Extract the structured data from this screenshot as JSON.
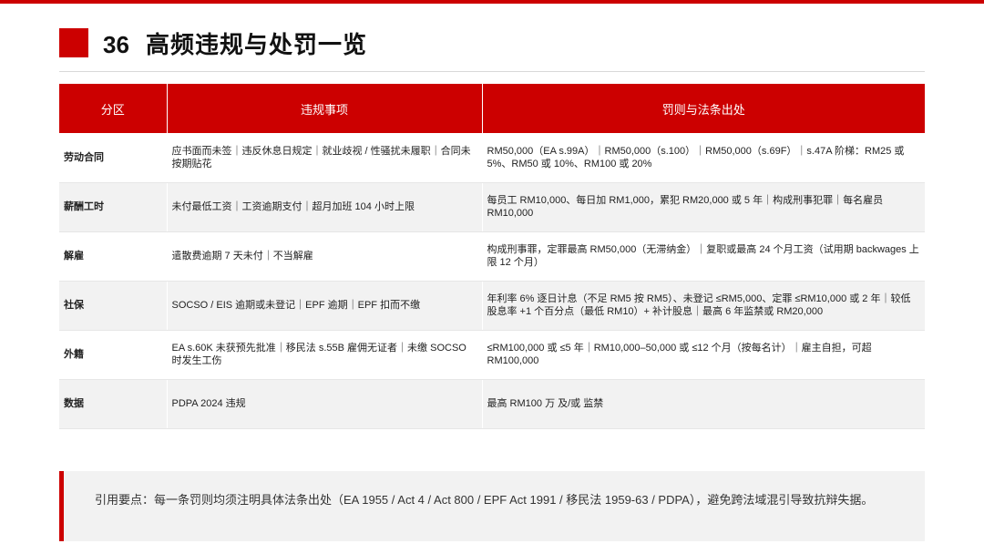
{
  "colors": {
    "accent": "#cc0000",
    "row_alt": "#f2f2f2"
  },
  "header": {
    "number": "36",
    "title": "高频违规与处罚一览"
  },
  "table": {
    "columns": [
      "分区",
      "违规事项",
      "罚则与法条出处"
    ],
    "rows": [
      {
        "zone": "劳动合同",
        "violation": "应书面而未签｜违反休息日规定｜就业歧视 / 性骚扰未履职｜合同未按期贴花",
        "penalty": "RM50,000（EA s.99A）｜RM50,000（s.100）｜RM50,000（s.69F）｜s.47A 阶梯：RM25 或 5%、RM50 或 10%、RM100 或 20%"
      },
      {
        "zone": "薪酬工时",
        "violation": "未付最低工资｜工资逾期支付｜超月加班 104 小时上限",
        "penalty": "每员工 RM10,000、每日加 RM1,000，累犯 RM20,000 或 5 年｜构成刑事犯罪｜每名雇员 RM10,000"
      },
      {
        "zone": "解雇",
        "violation": "遣散费逾期 7 天未付｜不当解雇",
        "penalty": "构成刑事罪，定罪最高 RM50,000（无滞纳金）｜复职或最高 24 个月工资（试用期 backwages 上限 12 个月）"
      },
      {
        "zone": "社保",
        "violation": "SOCSO / EIS 逾期或未登记｜EPF 逾期｜EPF 扣而不缴",
        "penalty": "年利率 6% 逐日计息（不足 RM5 按 RM5）、未登记 ≤RM5,000、定罪 ≤RM10,000 或 2 年｜较低股息率 +1 个百分点（最低 RM10）+ 补计股息｜最高 6 年监禁或 RM20,000"
      },
      {
        "zone": "外籍",
        "violation": "EA s.60K 未获预先批准｜移民法 s.55B 雇佣无证者｜未缴 SOCSO 时发生工伤",
        "penalty": "≤RM100,000 或 ≤5 年｜RM10,000–50,000 或 ≤12 个月（按每名计）｜雇主自担，可超 RM100,000"
      },
      {
        "zone": "数据",
        "violation": "PDPA 2024 违规",
        "penalty": "最高 RM100 万 及/或 监禁"
      }
    ]
  },
  "note": {
    "text": "引用要点：每一条罚则均须注明具体法条出处（EA 1955 / Act 4 / Act 800 / EPF Act 1991 / 移民法 1959-63 / PDPA），避免跨法域混引导致抗辩失据。"
  }
}
